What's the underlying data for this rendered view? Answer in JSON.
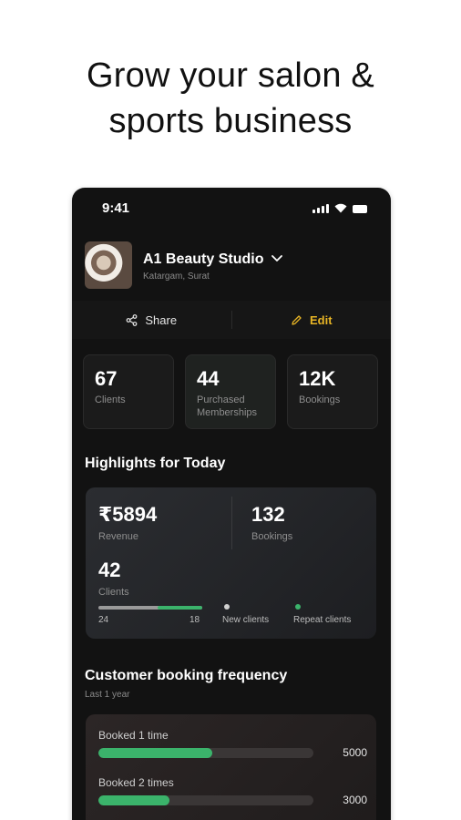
{
  "headline": {
    "line1": "Grow your salon &",
    "line2": "sports business"
  },
  "status_bar": {
    "time": "9:41",
    "icons": [
      "signal-icon",
      "wifi-icon",
      "battery-icon"
    ]
  },
  "studio": {
    "name": "A1 Beauty Studio",
    "location": "Katargam, Surat"
  },
  "actions": {
    "share_label": "Share",
    "edit_label": "Edit"
  },
  "stats": [
    {
      "value": "67",
      "label": "Clients"
    },
    {
      "value": "44",
      "label": "Purchased Memberships"
    },
    {
      "value": "12K",
      "label": "Bookings"
    }
  ],
  "highlights": {
    "title": "Highlights for Today",
    "revenue": {
      "value": "₹5894",
      "label": "Revenue"
    },
    "bookings": {
      "value": "132",
      "label": "Bookings"
    },
    "clients": {
      "value": "42",
      "label": "Clients"
    },
    "new_clients": 24,
    "repeat_clients": 18,
    "legend": {
      "new": "New clients",
      "repeat": "Repeat clients"
    }
  },
  "frequency": {
    "title": "Customer booking frequency",
    "subtitle": "Last 1 year",
    "rows": [
      {
        "label": "Booked 1 time",
        "value": 5000,
        "display": "5000",
        "fraction": 0.53
      },
      {
        "label": "Booked 2 times",
        "value": 3000,
        "display": "3000",
        "fraction": 0.33
      }
    ]
  },
  "colors": {
    "accent_edit": "#e8b525",
    "accent_green": "#3bb36b",
    "new_clients_dot": "#d0d0d0"
  }
}
